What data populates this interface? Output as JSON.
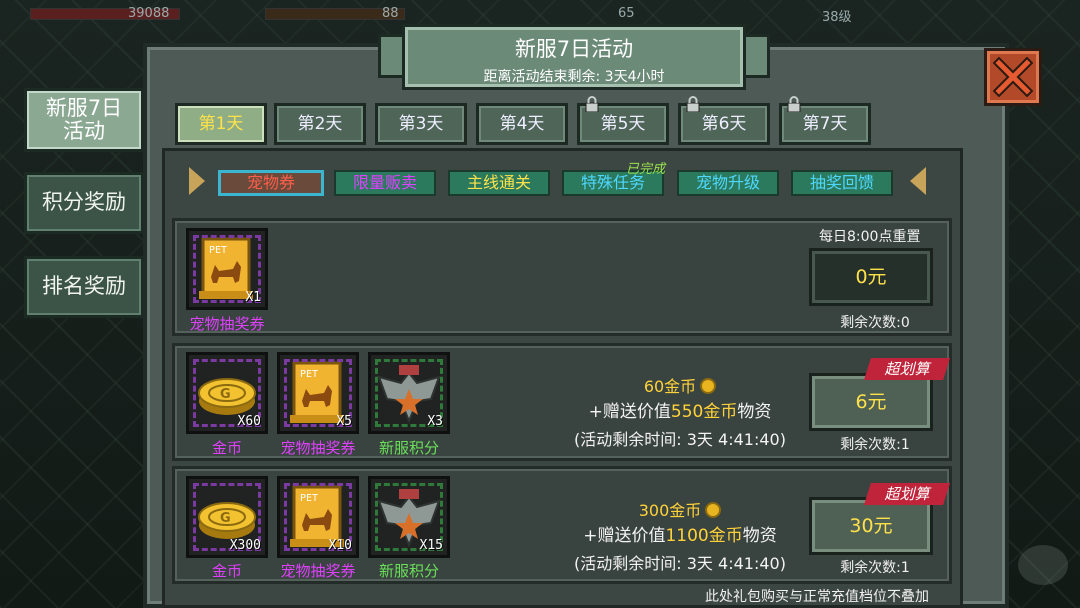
{
  "hud": {
    "left_value": "39088",
    "mid_value": "88",
    "right_value": "65",
    "level": "38级"
  },
  "side_tabs": [
    {
      "label": "新服7日\n活动",
      "active": true
    },
    {
      "label": "积分奖励",
      "active": false
    },
    {
      "label": "排名奖励",
      "active": false
    }
  ],
  "title": {
    "main": "新服7日活动",
    "sub": "距离活动结束剩余: 3天4小时"
  },
  "days": [
    {
      "label": "第1天",
      "active": true,
      "locked": false
    },
    {
      "label": "第2天",
      "active": false,
      "locked": false
    },
    {
      "label": "第3天",
      "active": false,
      "locked": false
    },
    {
      "label": "第4天",
      "active": false,
      "locked": false
    },
    {
      "label": "第5天",
      "active": false,
      "locked": true
    },
    {
      "label": "第6天",
      "active": false,
      "locked": true
    },
    {
      "label": "第7天",
      "active": false,
      "locked": true
    }
  ],
  "categories": [
    {
      "label": "宠物券",
      "active": true,
      "color": "#ff5d4a"
    },
    {
      "label": "限量贩卖",
      "active": false,
      "color": "#e040ff"
    },
    {
      "label": "主线通关",
      "active": false,
      "color": "#ffe24a"
    },
    {
      "label": "特殊任务",
      "active": false,
      "color": "#4fd8ff"
    },
    {
      "label": "宠物升级",
      "active": false,
      "color": "#4fd8ff"
    },
    {
      "label": "抽奖回馈",
      "active": false,
      "color": "#4fd8ff"
    }
  ],
  "done_tag": "已完成",
  "row1": {
    "item": {
      "label": "宠物抽奖券",
      "qty": "X1",
      "icon": "pet-ticket-icon"
    },
    "reset_text": "每日8:00点重置",
    "price": "0元",
    "remain": "剩余次数:0"
  },
  "row2": {
    "items": [
      {
        "label": "金币",
        "qty": "X60",
        "icon": "gold-coin-icon"
      },
      {
        "label": "宠物抽奖券",
        "qty": "X5",
        "icon": "pet-ticket-icon"
      },
      {
        "label": "新服积分",
        "qty": "X3",
        "icon": "eagle-emblem-icon"
      }
    ],
    "offer_main": "60金币",
    "offer_gift_pre": "+赠送价值",
    "offer_gift_value": "550金币",
    "offer_gift_post": "物资",
    "offer_time": "(活动剩余时间: 3天 4:41:40)",
    "badge": "超划算",
    "price": "6元",
    "remain": "剩余次数:1"
  },
  "row3": {
    "items": [
      {
        "label": "金币",
        "qty": "X300",
        "icon": "gold-coin-icon"
      },
      {
        "label": "宠物抽奖券",
        "qty": "X10",
        "icon": "pet-ticket-icon"
      },
      {
        "label": "新服积分",
        "qty": "X15",
        "icon": "eagle-emblem-icon"
      }
    ],
    "offer_main": "300金币",
    "offer_gift_pre": "+赠送价值",
    "offer_gift_value": "1100金币",
    "offer_gift_post": "物资",
    "offer_time": "(活动剩余时间: 3天 4:41:40)",
    "badge": "超划算",
    "price": "30元",
    "remain": "剩余次数:1"
  },
  "footer_note": "此处礼包购买与正常充值档位不叠加"
}
